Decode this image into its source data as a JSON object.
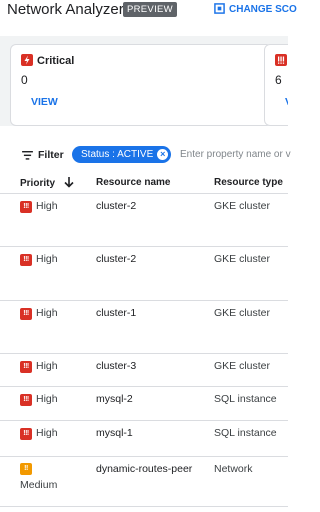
{
  "header": {
    "title": "Network Analyzer",
    "badge": "PREVIEW",
    "change_scope": "CHANGE SCO"
  },
  "summary": {
    "cards": [
      {
        "title": "Critical",
        "count": "0",
        "link": "VIEW"
      },
      {
        "title": "",
        "count": "6",
        "link": "V"
      }
    ]
  },
  "filter": {
    "label": "Filter",
    "chip": "Status : ACTIVE",
    "placeholder": "Enter property name or v"
  },
  "table": {
    "columns": [
      "Priority",
      "Resource name",
      "Resource type"
    ],
    "rows": [
      {
        "priority": "High",
        "name": "cluster-2",
        "type": "GKE cluster"
      },
      {
        "priority": "High",
        "name": "cluster-2",
        "type": "GKE cluster"
      },
      {
        "priority": "High",
        "name": "cluster-1",
        "type": "GKE cluster"
      },
      {
        "priority": "High",
        "name": "cluster-3",
        "type": "GKE cluster"
      },
      {
        "priority": "High",
        "name": "mysql-2",
        "type": "SQL instance"
      },
      {
        "priority": "High",
        "name": "mysql-1",
        "type": "SQL instance"
      },
      {
        "priority": "Medium",
        "name": "dynamic-routes-peer",
        "type": "Network"
      }
    ]
  },
  "colors": {
    "accent": "#1a73e8",
    "critical": "#d93025",
    "medium": "#f29900"
  }
}
